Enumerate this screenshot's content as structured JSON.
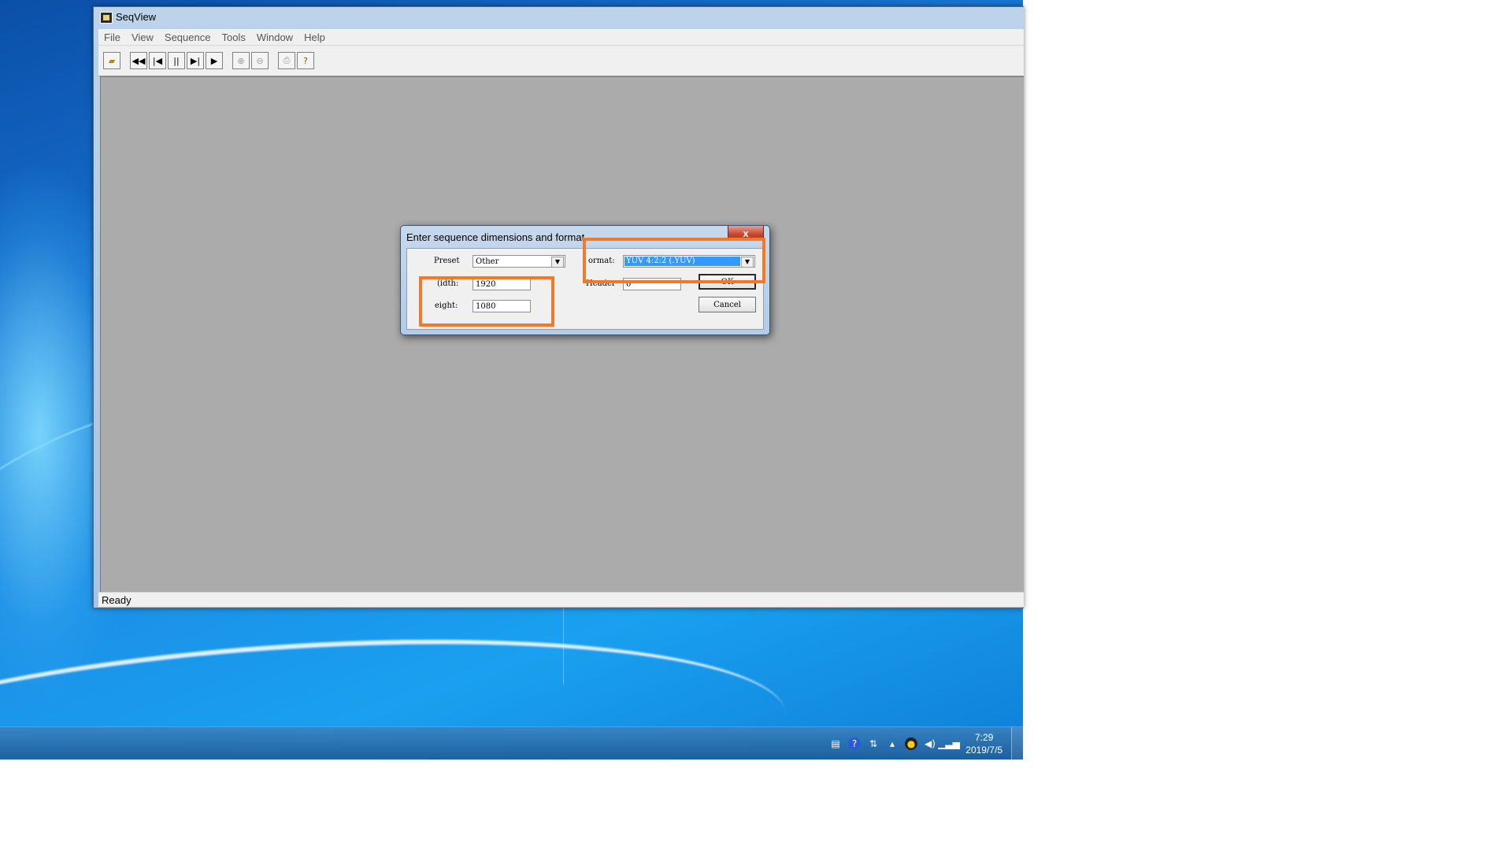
{
  "app": {
    "title": "SeqView",
    "menu": [
      "File",
      "View",
      "Sequence",
      "Tools",
      "Window",
      "Help"
    ],
    "toolbar_icons": [
      "open-icon",
      "rewind-icon",
      "step-back-icon",
      "pause-icon",
      "step-forward-icon",
      "play-icon",
      "zoom-in-icon",
      "zoom-out-icon",
      "print-icon",
      "help-icon"
    ],
    "status": "Ready"
  },
  "dialog": {
    "title": "Enter sequence dimensions and format",
    "close_label": "x",
    "preset_label": "Preset",
    "preset_value": "Other",
    "width_label": "(idth:",
    "width_value": "1920",
    "height_label": "eight:",
    "height_value": "1080",
    "format_label": "ormat:",
    "format_value": "YUV 4:2:2 (.YUV)",
    "header_label": "Header",
    "header_value": "0",
    "ok_label": "OK",
    "cancel_label": "Cancel"
  },
  "taskbar": {
    "time": "7:29",
    "date": "2019/7/5",
    "tray_icons": [
      "network-folder-icon",
      "help-circle-icon",
      "usb-icon",
      "arrow-up-icon",
      "qq-penguin-icon",
      "volume-icon",
      "signal-icon"
    ]
  },
  "colors": {
    "highlight": "#f07a2a",
    "selection": "#3399ff",
    "client_area": "#ababab"
  }
}
